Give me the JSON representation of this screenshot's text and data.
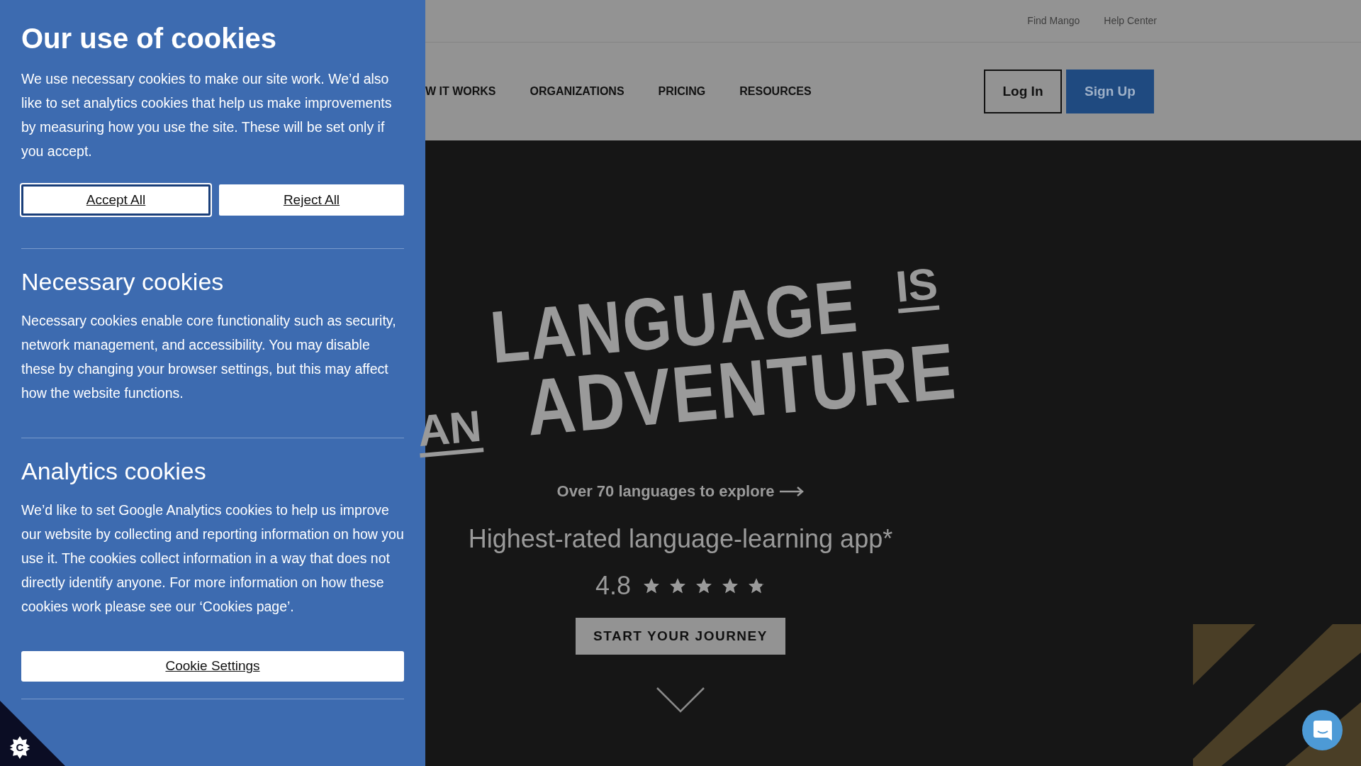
{
  "cookie_panel": {
    "title": "Our use of cookies",
    "intro": "We use necessary cookies to make our site work. We’d also like to set analytics cookies that help us make improvements by measuring how you use the site. These will be set only if you accept.",
    "buttons": [
      {
        "label": "Accept All",
        "selected": true
      },
      {
        "label": "Reject All",
        "selected": false
      }
    ],
    "sections": [
      {
        "heading": "Necessary cookies",
        "text": "Necessary cookies enable core functionality such as security, network management, and accessibility. You may disable these by changing your browser settings, but this may affect how the website functions."
      },
      {
        "heading": "Analytics cookies",
        "text": "We’d like to set Google Analytics cookies to help us improve our website by collecting and reporting information on how you use it. The cookies collect information in a way that does not directly identify anyone. For more information on how these cookies work please see our ‘Cookies page’."
      }
    ],
    "settings_button": "Cookie Settings",
    "badge_letter": "C"
  },
  "top_links": [
    "Find Mango",
    "Help Center"
  ],
  "nav": {
    "items": [
      "W IT WORKS",
      "ORGANIZATIONS",
      "PRICING",
      "RESOURCES"
    ],
    "log_in": "Log In",
    "sign_up": "Sign Up"
  },
  "hero": {
    "headline": [
      "LANGUAGE",
      "IS",
      "AN",
      "ADVENTURE"
    ],
    "languages_link": "Over 70 languages to explore",
    "tagline": "Highest-rated language-learning app*",
    "rating": "4.8",
    "stars": 4.8,
    "cta": "START YOUR JOURNEY"
  }
}
